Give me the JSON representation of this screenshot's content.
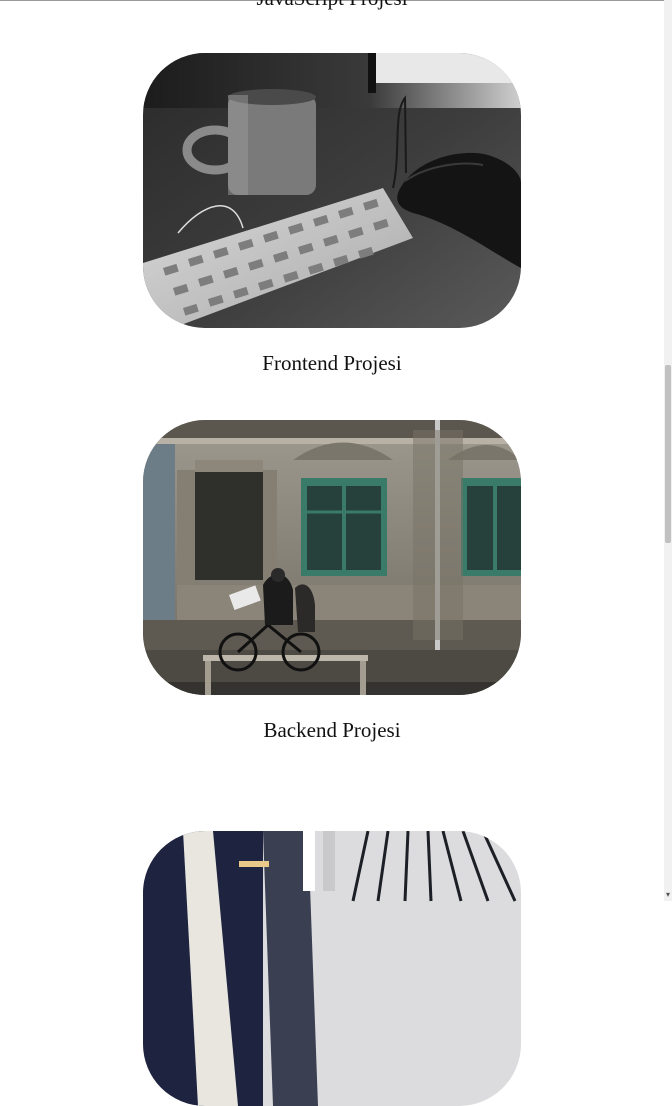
{
  "partial_heading": "JavaScript Projesi",
  "cards": [
    {
      "title": "Frontend Projesi",
      "image": "desk-keyboard-mug-photo"
    },
    {
      "title": "Backend Projesi",
      "image": "street-building-cyclist-photo"
    },
    {
      "title": "",
      "image": "building-facade-glass-photo"
    }
  ],
  "scrollbar": {
    "thumb_position_percent": 41
  }
}
